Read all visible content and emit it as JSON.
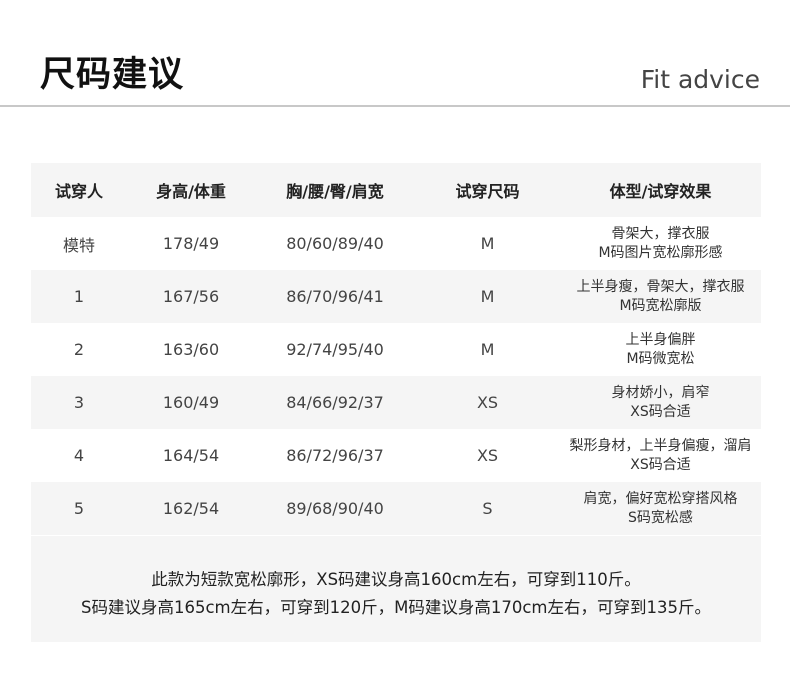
{
  "header": {
    "title_cn": "尺码建议",
    "title_en": "Fit advice"
  },
  "table": {
    "columns": [
      "试穿人",
      "身高/体重",
      "胸/腰/臀/肩宽",
      "试穿尺码",
      "体型/试穿效果"
    ],
    "rows": [
      {
        "model": "模特",
        "height_weight": "178/49",
        "measurements": "80/60/89/40",
        "size": "M",
        "effect": [
          "骨架大，撑衣服",
          "M码图片宽松廓形感"
        ]
      },
      {
        "model": "1",
        "height_weight": "167/56",
        "measurements": "86/70/96/41",
        "size": "M",
        "effect": [
          "上半身瘦，骨架大，撑衣服",
          "M码宽松廓版"
        ]
      },
      {
        "model": "2",
        "height_weight": "163/60",
        "measurements": "92/74/95/40",
        "size": "M",
        "effect": [
          "上半身偏胖",
          "M码微宽松"
        ]
      },
      {
        "model": "3",
        "height_weight": "160/49",
        "measurements": "84/66/92/37",
        "size": "XS",
        "effect": [
          "身材娇小，肩窄",
          "XS码合适"
        ]
      },
      {
        "model": "4",
        "height_weight": "164/54",
        "measurements": "86/72/96/37",
        "size": "XS",
        "effect": [
          "梨形身材，上半身偏瘦，溜肩",
          "XS码合适"
        ]
      },
      {
        "model": "5",
        "height_weight": "162/54",
        "measurements": "89/68/90/40",
        "size": "S",
        "effect": [
          "肩宽，偏好宽松穿搭风格",
          "S码宽松感"
        ]
      }
    ]
  },
  "note": {
    "line1": "此款为短款宽松廓形，XS码建议身高160cm左右，可穿到110斤。",
    "line2": "S码建议身高165cm左右，可穿到120斤，M码建议身高170cm左右，可穿到135斤。"
  },
  "colors": {
    "row_alt_bg": "#f5f5f5",
    "divider": "#c8c8c8",
    "title_text": "#111111"
  }
}
